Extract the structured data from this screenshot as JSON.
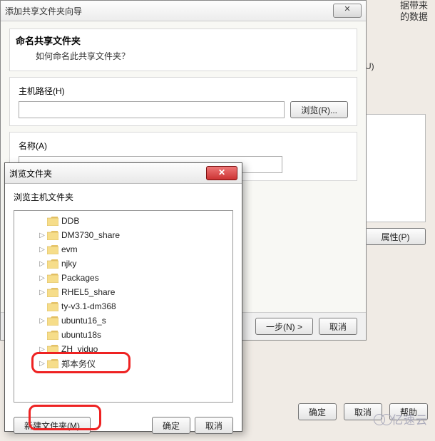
{
  "background": {
    "line1": "据带来",
    "line2": "的数据",
    "suffix": "U)"
  },
  "main_dialog": {
    "title": "添加共享文件夹向导",
    "heading": "命名共享文件夹",
    "subheading": "如何命名此共享文件夹？",
    "host_path_label": "主机路径(H)",
    "browse_button": "浏览(R)...",
    "name_label": "名称(A)",
    "next_button": "一步(N) >",
    "cancel_button": "取消"
  },
  "right_panel": {
    "properties_button": "属性(P)"
  },
  "back_buttons": {
    "ok": "确定",
    "cancel": "取消",
    "help": "帮助"
  },
  "browse_dialog": {
    "title": "浏览文件夹",
    "subtitle": "浏览主机文件夹",
    "new_folder_button": "新建文件夹(M)",
    "ok_button": "确定",
    "cancel_button": "取消",
    "close_glyph": "✕"
  },
  "tree": {
    "items": [
      {
        "label": "DDB",
        "expander": ""
      },
      {
        "label": "DM3730_share",
        "expander": "▷"
      },
      {
        "label": "evm",
        "expander": "▷"
      },
      {
        "label": "njky",
        "expander": "▷"
      },
      {
        "label": "Packages",
        "expander": "▷"
      },
      {
        "label": "RHEL5_share",
        "expander": "▷"
      },
      {
        "label": "ty-v3.1-dm368",
        "expander": ""
      },
      {
        "label": "ubuntu16_s",
        "expander": "▷"
      },
      {
        "label": "ubuntu18s",
        "expander": ""
      },
      {
        "label": "ZH_yiduo",
        "expander": "▷"
      },
      {
        "label": "郑本务仪",
        "expander": "▷"
      }
    ]
  },
  "logo_text": "亿速云"
}
